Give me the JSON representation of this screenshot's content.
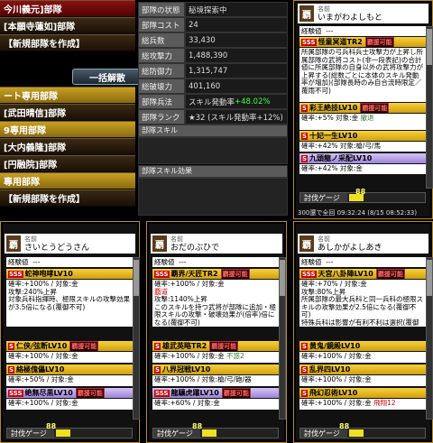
{
  "left_panel": {
    "rows": [
      "今川義元]部隊",
      "[本願寺蓮如]部隊",
      "【新規部隊を作成】",
      "ート専用部隊",
      "[武田晴信]部隊",
      "9専用部隊",
      "[大内義隆]部隊",
      "[円融院]部隊",
      "專用部隊",
      "【新規部隊を作成】"
    ],
    "bulk_release_label": "一括解散"
  },
  "stats": [
    {
      "label": "部隊の状態",
      "value": "秘境探索中"
    },
    {
      "label": "部隊コスト",
      "value": "24"
    },
    {
      "label": "総兵数",
      "value": "33,430"
    },
    {
      "label": "総攻撃力",
      "value": "1,488,390"
    },
    {
      "label": "総防御力",
      "value": "1,315,747"
    },
    {
      "label": "総破壊力",
      "value": "401,160"
    },
    {
      "label": "部隊兵法",
      "value": "スキル発動率+48.02%"
    },
    {
      "label": "部隊ランク",
      "value": "★32 (スキル発動率+12%)"
    }
  ],
  "stats_extra": {
    "skill_rate": "+48.02%",
    "skill_rate_prefix": "スキル発動率"
  },
  "party_skill_label": "部隊スキル",
  "party_skill_effect_label": "部隊スキル効果",
  "cards": [
    {
      "kanji": "覇",
      "name_label": "名前",
      "name": "いまがわよしもと",
      "cost_label": "cost",
      "lv_label": "LV.",
      "exp_label": "経験値",
      "exp_value": "---",
      "skill1": "SSS",
      "skill1_name": "怪童冥道TR2",
      "skill1_badge": "覇援可能",
      "text1": "所属部隊の弓兵科兵士攻撃力が上昇し所属部隊の武将コスト(非一段表記)の合計値に所属部隊の自身以外の武将攻撃力が上昇する(総数ごとに本体のスキル発動率が増加)(部隊長時のみ自合流時限定／覆雨不可)",
      "skill2": "彩王絶技LV10",
      "skill2_badge": "覇援可能",
      "text2a": "確率:+5%",
      "text2b": "対象:金",
      "text2c": "撤退",
      "skill3": "十妃一生LV10",
      "text3a": "確率:+42%",
      "text3b": "対象:槍/弓/馬",
      "skill4": "九頭龍ノ采配LV10",
      "text4a": "確率:+42%",
      "text4b": "対象:金",
      "gauge_label": "討伐ゲージ",
      "gauge": "88",
      "footer": "300還で全回 09:32:24 (8/15 08:52:33)"
    },
    {
      "kanji": "覇",
      "name_label": "名前",
      "name": "さいとうどうさん",
      "cost_label": "cost",
      "lv_label": "LV.",
      "exp_label": "経験値",
      "exp_value": "---",
      "skill1": "蛇神咆哮LV10",
      "text1": "確率:+100% / 対象:金",
      "text1b": "攻撃:240%上昇",
      "text1c": "対象兵科指揮時、極限スキルの攻撃効果が3.5倍になる(覆御不可)",
      "skill2": "仁侠/弦断LV10",
      "skill2_badge": "覇援可能",
      "text2a": "確率:+100% / 対象:金",
      "skill3": "絡極傀儡LV10",
      "text3a": "確率:+50% / 対象:金",
      "skill4": "絶無尽黒LV10",
      "skill4_badge": "覇援可能",
      "text4a": "確率:+100% / 対象:金",
      "gauge_label": "討伐ゲージ",
      "gauge": "88"
    },
    {
      "kanji": "覇",
      "name_label": "名前",
      "name": "おだのぶひで",
      "cost_label": "cost",
      "lv_label": "LV.",
      "exp_label": "経験値",
      "exp_value": "---",
      "skill1": "覇界/天匠TR2",
      "skill1_badge": "覇援可能",
      "text1": "確率:+100% / 対象:金",
      "text1b": "覇道",
      "text1c": "攻撃:1140%上昇",
      "text1d": "このスキルを持つ武将が部隊に追加・極限スキルの攻撃・破壊効果が(倍率)倍になる(覆御不可)",
      "skill2": "雄武英略TR2",
      "skill2_badge": "覇援可能",
      "text2a": "確率:+100% / 対象:金",
      "text2b": "不惑2",
      "skill3": "八界冠戦LV10",
      "text3a": "確率:+100% / 対象:槍/弓/砲/器",
      "skill4": "龍驤虎躍LV10",
      "skill4_badge": "覇援可能",
      "text4a": "確率:+60% / 対象:金",
      "gauge_label": "討伐ゲージ",
      "gauge": "88"
    },
    {
      "kanji": "覇",
      "name_label": "名前",
      "name": "あしかがよしあき",
      "cost_label": "cost",
      "lv_label": "LV.",
      "exp_label": "経験値",
      "exp_value": "---",
      "skill1": "天宮八卦陣LV10",
      "skill1_badge": "覇援可能",
      "text1": "確率:+70% / 対象:金",
      "text1b": "攻撃:80%上昇",
      "text1c": "所属部隊の最大兵科と同一兵科の極限スキルの攻撃効果が2.5倍になる(覆御不可)",
      "text1d": "特殊兵科は影響が有利不利は選択(覆御不可)",
      "skill2": "黄鬼/鏡殿LV10",
      "text2a": "確率:+100% / 対象:金",
      "skill3": "乱界四LV10",
      "text3a": "確率:+100% / 対象:金",
      "skill4": "飛幻忍術LV10",
      "text4a": "確率:+100% / 対象:金",
      "text4b": "飛翔12",
      "gauge_label": "討伐ゲージ",
      "gauge": "88"
    }
  ]
}
